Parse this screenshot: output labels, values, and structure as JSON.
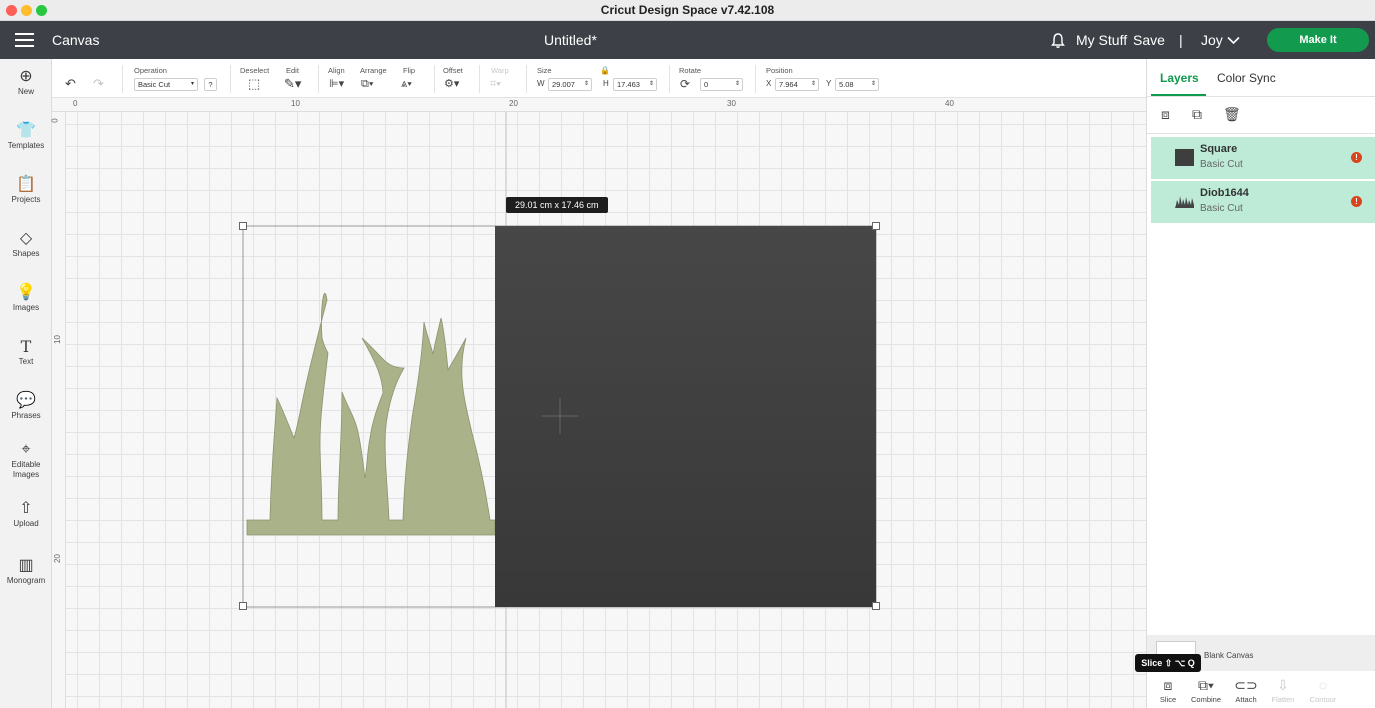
{
  "window": {
    "title": "Cricut Design Space  v7.42.108"
  },
  "header": {
    "section": "Canvas",
    "doc_title": "Untitled*",
    "my_stuff": "My Stuff",
    "save": "Save",
    "separator": "|",
    "user": "Joy",
    "make_it": "Make It"
  },
  "sidebar": {
    "items": [
      {
        "label": "New",
        "icon": "plus-circle-icon"
      },
      {
        "label": "Templates",
        "icon": "shirt-icon"
      },
      {
        "label": "Projects",
        "icon": "clipboard-icon"
      },
      {
        "label": "Shapes",
        "icon": "shapes-icon"
      },
      {
        "label": "Images",
        "icon": "lightbulb-icon"
      },
      {
        "label": "Text",
        "icon": "text-icon"
      },
      {
        "label": "Phrases",
        "icon": "speech-bubble-icon"
      },
      {
        "label": "Editable Images",
        "icon": "node-edit-icon"
      },
      {
        "label": "Upload",
        "icon": "upload-icon"
      },
      {
        "label": "Monogram",
        "icon": "monogram-icon"
      }
    ]
  },
  "toolbar": {
    "operation_label": "Operation",
    "operation_value": "Basic Cut",
    "operation_help": "?",
    "deselect_label": "Deselect",
    "edit_label": "Edit",
    "align_label": "Align",
    "arrange_label": "Arrange",
    "flip_label": "Flip",
    "offset_label": "Offset",
    "warp_label": "Warp",
    "size_label": "Size",
    "w_label": "W",
    "w_value": "29.007",
    "h_label": "H",
    "h_value": "17.463",
    "rotate_label": "Rotate",
    "rotate_value": "0",
    "position_label": "Position",
    "x_label": "X",
    "x_value": "7.964",
    "y_label": "Y",
    "y_value": "5.08"
  },
  "ruler": {
    "top": [
      "0",
      "10",
      "20",
      "30",
      "40"
    ],
    "left": [
      "0",
      "10",
      "20"
    ]
  },
  "canvas": {
    "size_badge": "29.01  cm x 17.46  cm",
    "colors": {
      "square": "#404040",
      "grass": "#aab28a"
    }
  },
  "layers_panel": {
    "tabs": [
      "Layers",
      "Color Sync"
    ],
    "layers": [
      {
        "name": "Square",
        "operation": "Basic Cut"
      },
      {
        "name": "Diob1644",
        "operation": "Basic Cut"
      }
    ],
    "blank_canvas": "Blank Canvas"
  },
  "bottom_tools": {
    "tooltip": "Slice ⇧ ⌥ Q",
    "items": [
      "Slice",
      "Combine",
      "Attach",
      "Flatten",
      "Contour"
    ]
  }
}
